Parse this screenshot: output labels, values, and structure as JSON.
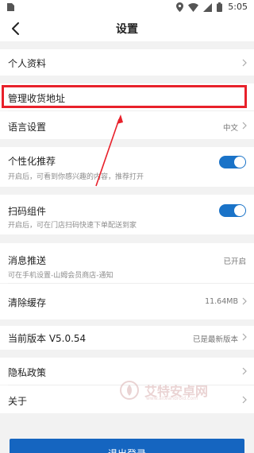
{
  "status_bar": {
    "time": "5:05"
  },
  "header": {
    "title": "设置"
  },
  "rows": {
    "profile": {
      "label": "个人资料"
    },
    "address": {
      "label": "管理收货地址"
    },
    "language": {
      "label": "语言设置",
      "value": "中文"
    },
    "personalized": {
      "label": "个性化推荐",
      "description": "开启后，可看到你感兴趣的内容，推荐打开",
      "enabled": true
    },
    "scan": {
      "label": "扫码组件",
      "description": "开启后，可在门店扫码快速下单配送到家",
      "enabled": true
    },
    "push": {
      "label": "消息推送",
      "value": "已开启",
      "description": "可在手机设置-山姆会员商店-通知"
    },
    "cache": {
      "label": "清除缓存",
      "value": "11.64MB"
    },
    "version": {
      "label": "当前版本 V5.0.54",
      "value": "已是最新版本"
    },
    "privacy": {
      "label": "隐私政策"
    },
    "about": {
      "label": "关于"
    }
  },
  "watermark": {
    "text": "艾特安卓网",
    "sub": "www.aiteandroid.com"
  },
  "footer": {
    "button_label": "退出登录"
  },
  "colors": {
    "highlight": "#e8212b",
    "toggle_on": "#1a73c8",
    "primary": "#1565c0"
  }
}
